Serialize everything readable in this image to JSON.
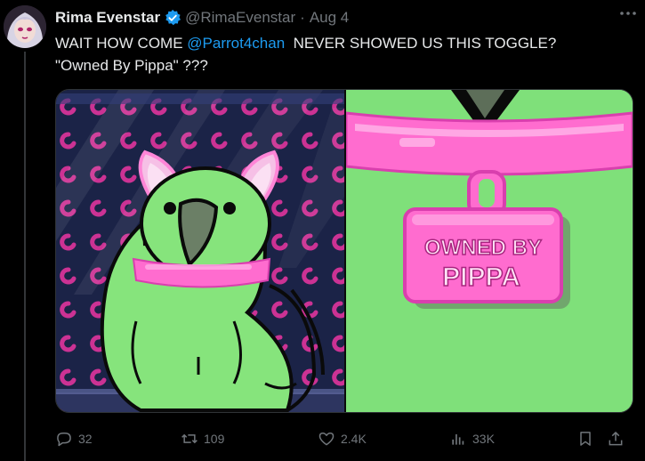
{
  "tweet": {
    "author_name": "Rima Evenstar",
    "handle": "@RimaEvenstar",
    "separator": "·",
    "date": "Aug 4",
    "text_before": "WAIT HOW COME ",
    "mention": "@Parrot4chan",
    "text_after": "  NEVER SHOWED US THIS TOGGLE?",
    "text_line2": "\"Owned By Pippa\" ???",
    "tag_text_line1": "OWNED BY",
    "tag_text_line2": "PIPPA"
  },
  "actions": {
    "replies": "32",
    "reposts": "109",
    "likes": "2.4K",
    "views": "33K"
  },
  "colors": {
    "accent": "#1d9bf0",
    "muted": "#71767b",
    "collar_pink": "#ff6ccf",
    "parrot_green": "#7fe07a"
  }
}
